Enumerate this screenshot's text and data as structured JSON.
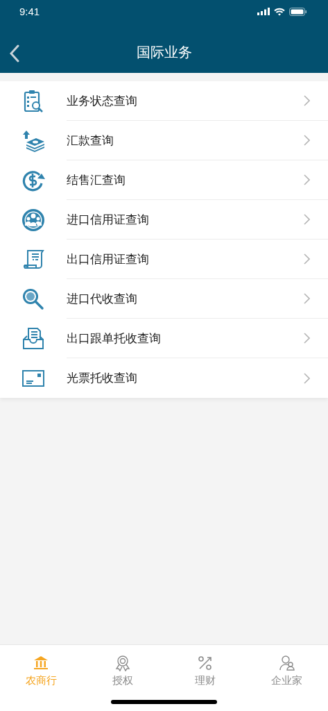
{
  "status_bar": {
    "time": "9:41"
  },
  "nav": {
    "title": "国际业务"
  },
  "menu": [
    {
      "label": "业务状态查询"
    },
    {
      "label": "汇款查询"
    },
    {
      "label": "结售汇查询"
    },
    {
      "label": "进口信用证查询"
    },
    {
      "label": "出口信用证查询"
    },
    {
      "label": "进口代收查询"
    },
    {
      "label": "出口跟单托收查询"
    },
    {
      "label": "光票托收查询"
    }
  ],
  "tab_bar": [
    {
      "label": "农商行",
      "selected": true
    },
    {
      "label": "授权",
      "selected": false
    },
    {
      "label": "理财",
      "selected": false
    },
    {
      "label": "企业家",
      "selected": false
    }
  ]
}
